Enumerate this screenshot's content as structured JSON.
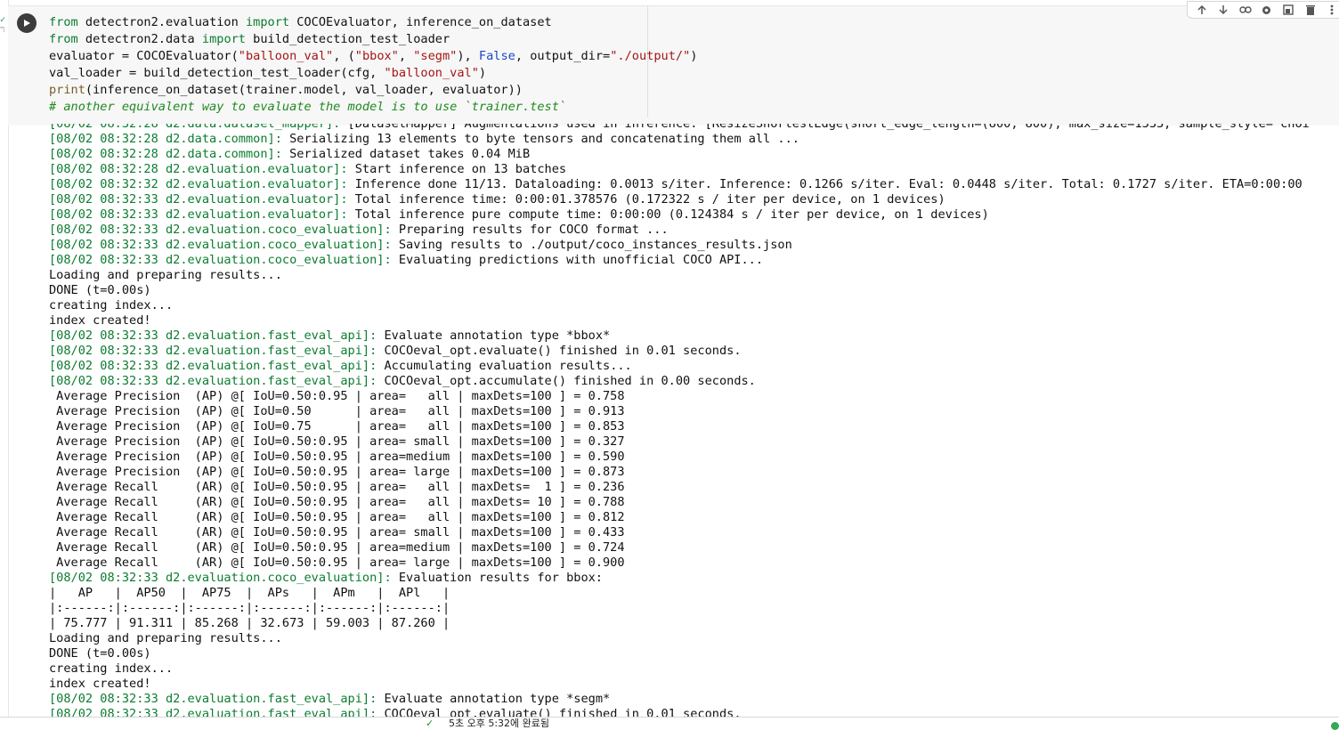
{
  "gutter": {
    "check": "✓",
    "mark": "ℸ"
  },
  "cell": {
    "code_lines": [
      [
        {
          "t": "from",
          "c": "kw"
        },
        {
          "t": " detectron2.evaluation "
        },
        {
          "t": "import",
          "c": "kw"
        },
        {
          "t": " COCOEvaluator, inference_on_dataset"
        }
      ],
      [
        {
          "t": "from",
          "c": "kw"
        },
        {
          "t": " detectron2.data "
        },
        {
          "t": "import",
          "c": "kw"
        },
        {
          "t": " build_detection_test_loader"
        }
      ],
      [
        {
          "t": "evaluator = COCOEvaluator("
        },
        {
          "t": "\"balloon_val\"",
          "c": "str"
        },
        {
          "t": ", ("
        },
        {
          "t": "\"bbox\"",
          "c": "str"
        },
        {
          "t": ", "
        },
        {
          "t": "\"segm\"",
          "c": "str"
        },
        {
          "t": "), "
        },
        {
          "t": "False",
          "c": "bool"
        },
        {
          "t": ", output_dir="
        },
        {
          "t": "\"./output/\"",
          "c": "str"
        },
        {
          "t": ")"
        }
      ],
      [
        {
          "t": "val_loader = build_detection_test_loader(cfg, "
        },
        {
          "t": "\"balloon_val\"",
          "c": "str"
        },
        {
          "t": ")"
        }
      ],
      [
        {
          "t": "print",
          "c": "fn"
        },
        {
          "t": "(inference_on_dataset(trainer.model, val_loader, evaluator))"
        }
      ],
      [
        {
          "t": "# another equivalent way to evaluate the model is to use `trainer.test`",
          "c": "cmt"
        }
      ]
    ]
  },
  "output": {
    "lines": [
      {
        "p": "[08/02 08:32:28 d2.data.dataset_mapper]:",
        "r": " [DatasetMapper] Augmentations used in inference: [ResizeShortestEdge(short_edge_length=(800, 800), max_size=1333, sample_style='choi",
        "cut": true
      },
      {
        "p": "[08/02 08:32:28 d2.data.common]:",
        "r": " Serializing 13 elements to byte tensors and concatenating them all ..."
      },
      {
        "p": "[08/02 08:32:28 d2.data.common]:",
        "r": " Serialized dataset takes 0.04 MiB"
      },
      {
        "p": "[08/02 08:32:28 d2.evaluation.evaluator]:",
        "r": " Start inference on 13 batches"
      },
      {
        "p": "[08/02 08:32:32 d2.evaluation.evaluator]:",
        "r": " Inference done 11/13. Dataloading: 0.0013 s/iter. Inference: 0.1266 s/iter. Eval: 0.0448 s/iter. Total: 0.1727 s/iter. ETA=0:00:00"
      },
      {
        "p": "[08/02 08:32:33 d2.evaluation.evaluator]:",
        "r": " Total inference time: 0:00:01.378576 (0.172322 s / iter per device, on 1 devices)"
      },
      {
        "p": "[08/02 08:32:33 d2.evaluation.evaluator]:",
        "r": " Total inference pure compute time: 0:00:00 (0.124384 s / iter per device, on 1 devices)"
      },
      {
        "p": "[08/02 08:32:33 d2.evaluation.coco_evaluation]:",
        "r": " Preparing results for COCO format ..."
      },
      {
        "p": "[08/02 08:32:33 d2.evaluation.coco_evaluation]:",
        "r": " Saving results to ./output/coco_instances_results.json"
      },
      {
        "p": "[08/02 08:32:33 d2.evaluation.coco_evaluation]:",
        "r": " Evaluating predictions with unofficial COCO API..."
      },
      {
        "p": "",
        "r": "Loading and preparing results..."
      },
      {
        "p": "",
        "r": "DONE (t=0.00s)"
      },
      {
        "p": "",
        "r": "creating index..."
      },
      {
        "p": "",
        "r": "index created!"
      },
      {
        "p": "[08/02 08:32:33 d2.evaluation.fast_eval_api]:",
        "r": " Evaluate annotation type *bbox*"
      },
      {
        "p": "[08/02 08:32:33 d2.evaluation.fast_eval_api]:",
        "r": " COCOeval_opt.evaluate() finished in 0.01 seconds."
      },
      {
        "p": "[08/02 08:32:33 d2.evaluation.fast_eval_api]:",
        "r": " Accumulating evaluation results..."
      },
      {
        "p": "[08/02 08:32:33 d2.evaluation.fast_eval_api]:",
        "r": " COCOeval_opt.accumulate() finished in 0.00 seconds."
      },
      {
        "p": "",
        "r": " Average Precision  (AP) @[ IoU=0.50:0.95 | area=   all | maxDets=100 ] = 0.758"
      },
      {
        "p": "",
        "r": " Average Precision  (AP) @[ IoU=0.50      | area=   all | maxDets=100 ] = 0.913"
      },
      {
        "p": "",
        "r": " Average Precision  (AP) @[ IoU=0.75      | area=   all | maxDets=100 ] = 0.853"
      },
      {
        "p": "",
        "r": " Average Precision  (AP) @[ IoU=0.50:0.95 | area= small | maxDets=100 ] = 0.327"
      },
      {
        "p": "",
        "r": " Average Precision  (AP) @[ IoU=0.50:0.95 | area=medium | maxDets=100 ] = 0.590"
      },
      {
        "p": "",
        "r": " Average Precision  (AP) @[ IoU=0.50:0.95 | area= large | maxDets=100 ] = 0.873"
      },
      {
        "p": "",
        "r": " Average Recall     (AR) @[ IoU=0.50:0.95 | area=   all | maxDets=  1 ] = 0.236"
      },
      {
        "p": "",
        "r": " Average Recall     (AR) @[ IoU=0.50:0.95 | area=   all | maxDets= 10 ] = 0.788"
      },
      {
        "p": "",
        "r": " Average Recall     (AR) @[ IoU=0.50:0.95 | area=   all | maxDets=100 ] = 0.812"
      },
      {
        "p": "",
        "r": " Average Recall     (AR) @[ IoU=0.50:0.95 | area= small | maxDets=100 ] = 0.433"
      },
      {
        "p": "",
        "r": " Average Recall     (AR) @[ IoU=0.50:0.95 | area=medium | maxDets=100 ] = 0.724"
      },
      {
        "p": "",
        "r": " Average Recall     (AR) @[ IoU=0.50:0.95 | area= large | maxDets=100 ] = 0.900"
      },
      {
        "p": "[08/02 08:32:33 d2.evaluation.coco_evaluation]:",
        "r": " Evaluation results for bbox:"
      },
      {
        "p": "",
        "r": "|   AP   |  AP50  |  AP75  |  APs   |  APm   |  APl   |"
      },
      {
        "p": "",
        "r": "|:------:|:------:|:------:|:------:|:------:|:------:|"
      },
      {
        "p": "",
        "r": "| 75.777 | 91.311 | 85.268 | 32.673 | 59.003 | 87.260 |"
      },
      {
        "p": "",
        "r": "Loading and preparing results..."
      },
      {
        "p": "",
        "r": "DONE (t=0.00s)"
      },
      {
        "p": "",
        "r": "creating index..."
      },
      {
        "p": "",
        "r": "index created!"
      },
      {
        "p": "[08/02 08:32:33 d2.evaluation.fast_eval_api]:",
        "r": " Evaluate annotation type *segm*"
      },
      {
        "p": "[08/02 08:32:33 d2.evaluation.fast_eval_api]:",
        "r": " COCOeval_opt.evaluate() finished in 0.01 seconds.",
        "cut": true
      }
    ]
  },
  "statusbar": {
    "check": "✓",
    "text": "5초    오후 5:32에 완료됨"
  },
  "colors": {
    "prefix_green": "#0b7c2f",
    "keyword": "#0b7c2f",
    "string": "#a31515",
    "bool": "#1a45c7"
  },
  "toolbar_icons": [
    "arrow-up-icon",
    "arrow-down-icon",
    "link-icon",
    "gear-icon",
    "mirror-cell-icon",
    "delete-icon",
    "more-icon"
  ]
}
